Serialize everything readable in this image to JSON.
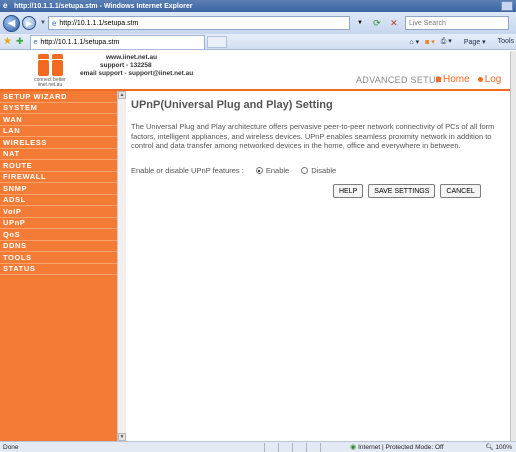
{
  "browser": {
    "title": "http://10.1.1.1/setupa.stm - Windows Internet Explorer",
    "address": "http://10.1.1.1/setupa.stm",
    "search_placeholder": "Live Search",
    "tab_label": "http://10.1.1.1/setupa.stm",
    "cmd_page": "Page",
    "cmd_tools": "Tools",
    "status_left": "Done",
    "status_zone": "Internet | Protected Mode: Off",
    "zoom": "100%"
  },
  "header": {
    "logo_tag_line1": "connect better",
    "logo_tag_line2": "iinet.net.au",
    "contact_line1": "www.iinet.net.au",
    "contact_line2": "support - 132258",
    "contact_line3": "email support - support@iinet.net.au",
    "advanced_setup": "ADVANCED SETUP",
    "home_link": "Home",
    "logout_link": "Log"
  },
  "sidebar": {
    "items": [
      {
        "label": "SETUP WIZARD"
      },
      {
        "label": "SYSTEM"
      },
      {
        "label": "WAN"
      },
      {
        "label": "LAN"
      },
      {
        "label": "WIRELESS"
      },
      {
        "label": "NAT"
      },
      {
        "label": "ROUTE"
      },
      {
        "label": "FIREWALL"
      },
      {
        "label": "SNMP"
      },
      {
        "label": "ADSL"
      },
      {
        "label": "VoIP"
      },
      {
        "label": "UPnP"
      },
      {
        "label": "QoS"
      },
      {
        "label": "DDNS"
      },
      {
        "label": "TOOLS"
      },
      {
        "label": "STATUS"
      }
    ]
  },
  "main": {
    "title": "UPnP(Universal Plug and Play) Setting",
    "description": "The Universal Plug and Play architecture offers pervasive peer-to-peer network connectivity of PCs of all form factors, intelligent appliances, and wireless devices. UPnP enables seamless proximity network in addition to control and data transfer among networked devices in the home, office and everywhere in between.",
    "setting_label": "Enable or disable UPnP features :",
    "enable_label": "Enable",
    "disable_label": "Disable",
    "selected": "Enable",
    "help_button": "HELP",
    "save_button": "SAVE SETTINGS",
    "cancel_button": "CANCEL"
  },
  "colors": {
    "accent": "#f26a22",
    "sidebar": "#f47b35"
  }
}
